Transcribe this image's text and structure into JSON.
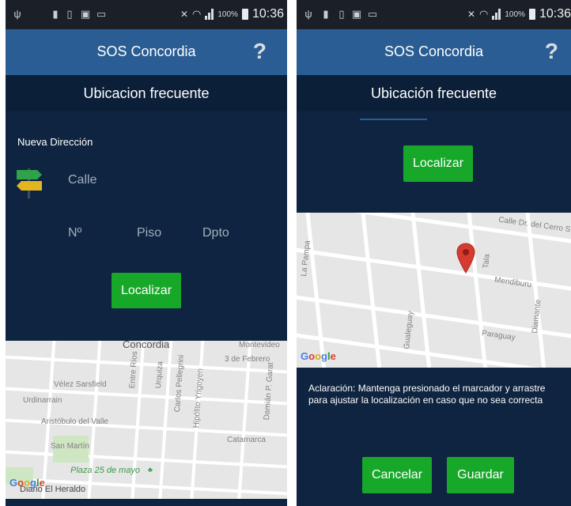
{
  "screens": [
    {
      "status": {
        "battery": "100%",
        "time": "10:36"
      },
      "app_title": "SOS Concordia",
      "help_label": "?",
      "subtitle": "Ubicacion frecuente",
      "section_label": "Nueva Dirección",
      "fields": {
        "street_placeholder": "Calle",
        "number_placeholder": "Nº",
        "floor_placeholder": "Piso",
        "apartment_placeholder": "Dpto"
      },
      "locate_button": "Localizar",
      "map": {
        "title": "Concordia",
        "labels": [
          "Montevideo",
          "3 de Febrero",
          "Vélez Sarsfield",
          "Urdinarrain",
          "Entre Ríos",
          "Urquiza",
          "Carlos Pellegrini",
          "Hipólito Yrigoyen",
          "Damián P. Garat",
          "Aristóbulo del Valle",
          "San Martín",
          "Catamarca",
          "Plaza 25 de mayo",
          "Diario El Heraldo"
        ],
        "attribution": "Google"
      }
    },
    {
      "status": {
        "battery": "100%",
        "time": "10:36"
      },
      "app_title": "SOS Concordia",
      "help_label": "?",
      "subtitle": "Ubicación frecuente",
      "locate_button": "Localizar",
      "map": {
        "labels": [
          "Calle Dr. del Cerro S",
          "La Pampa",
          "Tala",
          "Mendiburu",
          "Gualeguay",
          "Diamante",
          "Paraguay"
        ],
        "attribution": "Google"
      },
      "note": "Aclaración: Mantenga presionado el marcador y arrastre para ajustar la localización en caso que no sea correcta",
      "cancel_button": "Cancelar",
      "save_button": "Guardar"
    }
  ],
  "colors": {
    "app_bar": "#2a5d93",
    "background": "#0e2440",
    "button": "#17a82a",
    "marker": "#d63b2f"
  },
  "icons": {
    "status_left": [
      "usb-icon",
      "sim-icon",
      "screenshot-icon",
      "gallery-icon",
      "voicemail-icon"
    ],
    "status_right": [
      "mute-icon",
      "wifi-icon",
      "signal-icon",
      "battery-icon"
    ],
    "street_field": "street-sign-icon",
    "map_pin": "map-marker-icon",
    "map_place": "place-pin-icon"
  }
}
